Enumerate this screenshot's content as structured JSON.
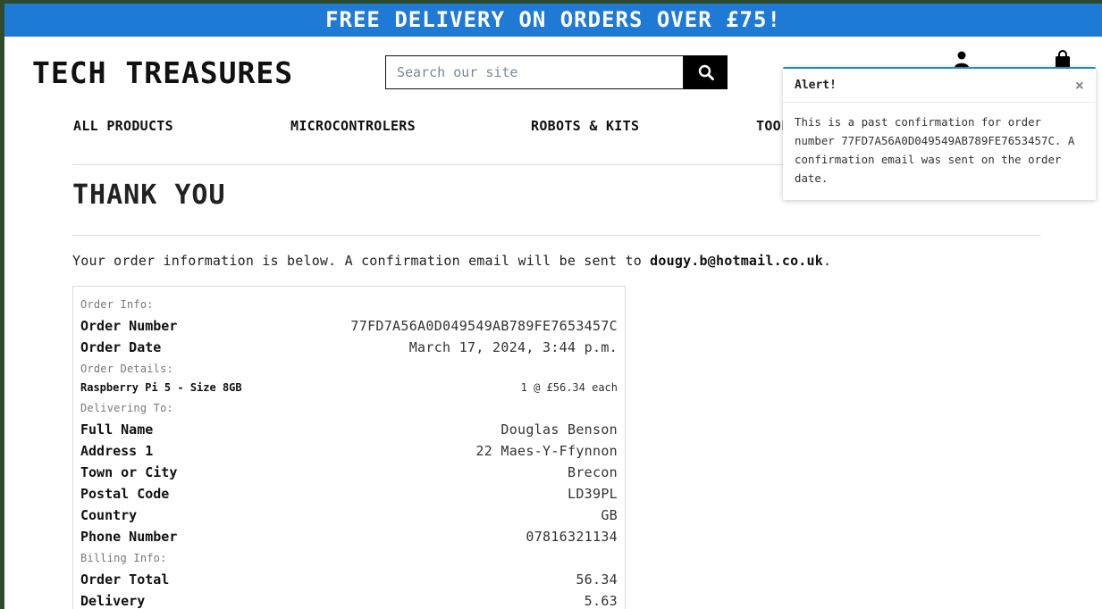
{
  "banner": {
    "text": "FREE DELIVERY ON ORDERS OVER £75!"
  },
  "header": {
    "logo": "TECH TREASURES",
    "search_placeholder": "Search our site",
    "search_icon": "search-icon",
    "account_icon": "user-icon",
    "bag_icon": "shopping-bag-icon"
  },
  "nav": {
    "items": [
      "ALL PRODUCTS",
      "MICROCONTROLERS",
      "ROBOTS & KITS",
      "TOOL"
    ]
  },
  "page": {
    "title": "THANK YOU",
    "info_prefix": "Your order information is below. A confirmation email will be sent to ",
    "email": "dougy.b@hotmail.co.uk",
    "info_suffix": "."
  },
  "order": {
    "order_info_heading": "Order Info:",
    "order_number_label": "Order Number",
    "order_number": "77FD7A56A0D049549AB789FE7653457C",
    "order_date_label": "Order Date",
    "order_date": "March 17, 2024, 3:44 p.m.",
    "order_details_heading": "Order Details:",
    "item_name": "Raspberry Pi 5 - Size 8GB",
    "item_qty_price": "1 @ £56.34 each",
    "delivering_heading": "Delivering To:",
    "full_name_label": "Full Name",
    "full_name": "Douglas Benson",
    "address1_label": "Address 1",
    "address1": "22 Maes-Y-Ffynnon",
    "town_label": "Town or City",
    "town": "Brecon",
    "postal_label": "Postal Code",
    "postal": "LD39PL",
    "country_label": "Country",
    "country": "GB",
    "phone_label": "Phone Number",
    "phone": "07816321134",
    "billing_heading": "Billing Info:",
    "total_label": "Order Total",
    "total": "56.34",
    "delivery_label": "Delivery",
    "delivery": "5.63"
  },
  "toast": {
    "title": "Alert!",
    "close": "×",
    "message": "This is a past confirmation for order number 77FD7A56A0D049549AB789FE7653457C. A confirmation email was sent on the order date."
  },
  "colors": {
    "banner": "#1f7ad6",
    "toast_accent": "#1a8fb9",
    "search_button": "#000000"
  }
}
